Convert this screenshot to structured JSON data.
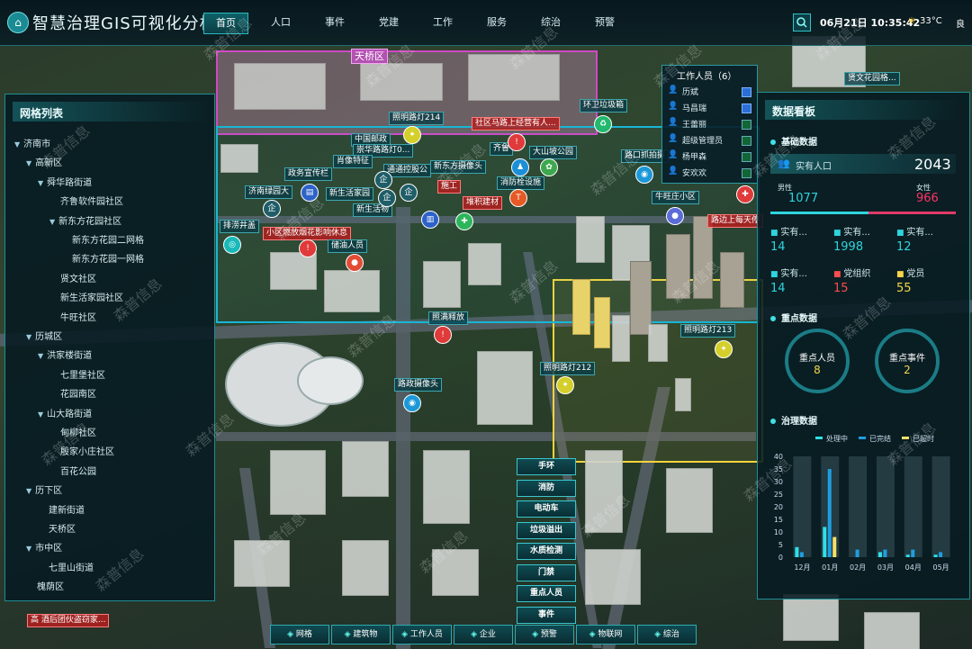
{
  "header": {
    "title": "智慧治理GIS可视化分析",
    "nav": [
      "首页",
      "人口",
      "事件",
      "党建",
      "工作",
      "服务",
      "综治",
      "预警"
    ],
    "active_nav": "首页",
    "datetime": "06月21日 10:35:42",
    "temperature": "33°C",
    "air_quality": "良"
  },
  "left_panel": {
    "title": "网格列表",
    "tree": [
      {
        "label": "济南市",
        "expanded": true
      },
      {
        "label": "高新区",
        "expanded": true
      },
      {
        "label": "舜华路街道",
        "expanded": true
      },
      {
        "label": "齐鲁软件园社区"
      },
      {
        "label": "新东方花园社区",
        "expanded": true
      },
      {
        "label": "新东方花园二网格"
      },
      {
        "label": "新东方花园一网格"
      },
      {
        "label": "贤文社区"
      },
      {
        "label": "新生活家园社区"
      },
      {
        "label": "牛旺社区"
      },
      {
        "label": "历城区",
        "expanded": true
      },
      {
        "label": "洪家楼街道",
        "expanded": true
      },
      {
        "label": "七里堡社区"
      },
      {
        "label": "花园南区"
      },
      {
        "label": "山大路街道",
        "expanded": true
      },
      {
        "label": "甸柳社区"
      },
      {
        "label": "殷家小庄社区"
      },
      {
        "label": "百花公园"
      },
      {
        "label": "历下区",
        "expanded": true
      },
      {
        "label": "建新街道"
      },
      {
        "label": "天桥区"
      },
      {
        "label": "市中区",
        "expanded": true
      },
      {
        "label": "七里山街道"
      },
      {
        "label": "槐荫区"
      }
    ]
  },
  "staff_popup": {
    "title": "工作人员（6）",
    "members": [
      {
        "name": "历斌",
        "checked": true
      },
      {
        "name": "马昌瑞",
        "checked": true
      },
      {
        "name": "王蕾丽",
        "checked": false
      },
      {
        "name": "超级管理员",
        "checked": false
      },
      {
        "name": "杨甲森",
        "checked": false
      },
      {
        "name": "安欢欢",
        "checked": false
      }
    ]
  },
  "right_panel": {
    "title": "数据看板",
    "basic": {
      "section": "基础数据",
      "population_label": "实有人口",
      "population_value": "2043",
      "male_label": "男性",
      "male_value": "1077",
      "female_label": "女性",
      "female_value": "966",
      "stats": [
        {
          "label": "实有...",
          "value": "14",
          "color": "#2fd4de"
        },
        {
          "label": "实有...",
          "value": "1998",
          "color": "#2fd4de"
        },
        {
          "label": "实有...",
          "value": "12",
          "color": "#2fd4de"
        },
        {
          "label": "实有...",
          "value": "14",
          "color": "#2fd4de"
        },
        {
          "label": "党组织",
          "value": "15",
          "color": "#ff4c4c"
        },
        {
          "label": "党员",
          "value": "55",
          "color": "#f7d54a"
        }
      ]
    },
    "key": {
      "section": "重点数据",
      "people_label": "重点人员",
      "people_value": "8",
      "events_label": "重点事件",
      "events_value": "2"
    },
    "govern": {
      "section": "治理数据"
    }
  },
  "chart_data": {
    "type": "bar",
    "categories": [
      "12月",
      "01月",
      "02月",
      "03月",
      "04月",
      "05月"
    ],
    "series": [
      {
        "name": "处理中",
        "values": [
          4,
          12,
          0,
          2,
          1,
          1
        ],
        "color": "#2fe0e8"
      },
      {
        "name": "已完结",
        "values": [
          2,
          35,
          3,
          3,
          3,
          2
        ],
        "color": "#1e9ee0"
      },
      {
        "name": "已超时",
        "values": [
          0,
          8,
          0,
          0,
          0,
          0
        ],
        "color": "#f7e06a"
      }
    ],
    "ylim": [
      0,
      40
    ],
    "yticks": [
      0,
      5,
      10,
      15,
      20,
      25,
      30,
      35,
      40
    ]
  },
  "map": {
    "district_label": "天桥区",
    "labels": [
      {
        "text": "照明路灯214",
        "style": "teal"
      },
      {
        "text": "社区马路上经营有人...",
        "style": "red"
      },
      {
        "text": "环卫垃圾箱",
        "style": "teal"
      },
      {
        "text": "中国邮政",
        "style": "teal"
      },
      {
        "text": "崇华路路灯0...",
        "style": "teal"
      },
      {
        "text": "齐鲁",
        "style": "teal"
      },
      {
        "text": "大山坡公园",
        "style": "teal"
      },
      {
        "text": "肖像特征",
        "style": "teal"
      },
      {
        "text": "通通控股公",
        "style": "teal"
      },
      {
        "text": "新东方摄像头",
        "style": "teal"
      },
      {
        "text": "路口抓拍摄",
        "style": "teal"
      },
      {
        "text": "政务宣传栏",
        "style": "teal"
      },
      {
        "text": "消防栓设施",
        "style": "teal"
      },
      {
        "text": "牛旺庄小区",
        "style": "teal"
      },
      {
        "text": "济南绿园大",
        "style": "teal"
      },
      {
        "text": "新生活家园",
        "style": "teal"
      },
      {
        "text": "施工",
        "style": "red"
      },
      {
        "text": "堆积建材",
        "style": "red"
      },
      {
        "text": "路边上每天停",
        "style": "red"
      },
      {
        "text": "新生活物",
        "style": "teal"
      },
      {
        "text": "排涝井盖",
        "style": "teal"
      },
      {
        "text": "小区燃放烟花影响休息",
        "style": "red"
      },
      {
        "text": "储油人员",
        "style": "teal"
      },
      {
        "text": "照明路灯213",
        "style": "teal"
      },
      {
        "text": "照明路灯212",
        "style": "teal"
      },
      {
        "text": "照满释放",
        "style": "teal"
      },
      {
        "text": "路政摄像头",
        "style": "teal"
      },
      {
        "text": "高 酒后团伙盗窃家...",
        "style": "red"
      },
      {
        "text": "贤文花园格...",
        "style": "teal"
      }
    ],
    "side_buttons": [
      "手环",
      "消防",
      "电动车",
      "垃圾溢出",
      "水质检测",
      "门禁",
      "重点人员",
      "事件"
    ],
    "bottom_buttons": [
      "网格",
      "建筑物",
      "工作人员",
      "企业",
      "预警",
      "物联网",
      "综治"
    ]
  },
  "watermark": "森普信息"
}
